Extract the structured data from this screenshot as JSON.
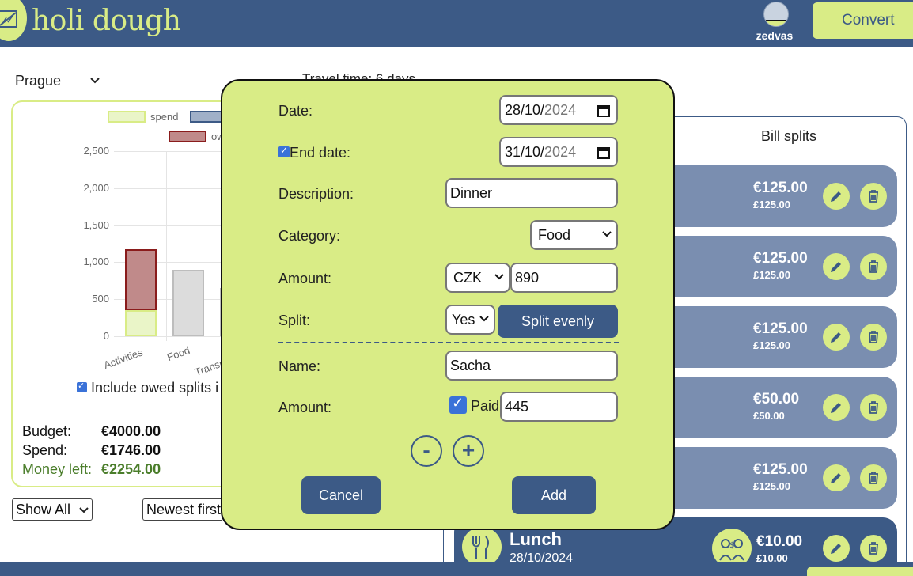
{
  "header": {
    "app_name": "holi dough",
    "username": "zedvas",
    "convert_label": "Convert"
  },
  "filters": {
    "city": "Prague",
    "travel_time": "Travel time: 6 days",
    "show_option": "Show All",
    "sort_option": "Newest first"
  },
  "chart_data": {
    "type": "bar",
    "categories": [
      "Activities",
      "Food",
      "Transport"
    ],
    "series": [
      {
        "name": "spend",
        "values": [
          350,
          900,
          650
        ],
        "color": "#eaf5c8"
      },
      {
        "name": "owed",
        "values": [
          820,
          0,
          0
        ],
        "color": "#c08a8a"
      }
    ],
    "ylim": [
      0,
      2500
    ],
    "yticks": [
      "2,500",
      "2,000",
      "1,500",
      "1,000",
      "500",
      "0"
    ],
    "legend": [
      "spend",
      "ow"
    ],
    "stacked": true
  },
  "include_owed_label": "Include owed splits i",
  "stats": {
    "budget_label": "Budget:",
    "budget_value": "€4000.00",
    "spend_label": "Spend:",
    "spend_value": "€1746.00",
    "left_label": "Money left:",
    "left_value": "€2254.00"
  },
  "tabs": {
    "bill_splits": "Bill splits"
  },
  "expenses": [
    {
      "amount": "€125.00",
      "converted": "£125.00"
    },
    {
      "amount": "€125.00",
      "converted": "£125.00"
    },
    {
      "amount": "€125.00",
      "converted": "£125.00"
    },
    {
      "amount": "€50.00",
      "converted": "£50.00"
    },
    {
      "amount": "€125.00",
      "converted": "£125.00"
    },
    {
      "title": "Lunch",
      "date": "28/10/2024",
      "amount": "€10.00",
      "converted": "£10.00"
    }
  ],
  "modal": {
    "date_label": "Date:",
    "date_day": "28/10/",
    "date_year": "2024",
    "end_date_label": "End date:",
    "end_day": "31/10/",
    "end_year": "2024",
    "description_label": "Description:",
    "description_value": "Dinner",
    "category_label": "Category:",
    "category_value": "Food",
    "amount_label": "Amount:",
    "currency_value": "CZK",
    "amount_value": "890",
    "split_label": "Split:",
    "split_value": "Yes",
    "split_evenly_label": "Split evenly",
    "name_label": "Name:",
    "name_value": "Sacha",
    "person_amount_label": "Amount:",
    "paid_label": "Paid",
    "person_amount_value": "445",
    "minus_label": "-",
    "plus_label": "+",
    "cancel_label": "Cancel",
    "add_label": "Add"
  }
}
